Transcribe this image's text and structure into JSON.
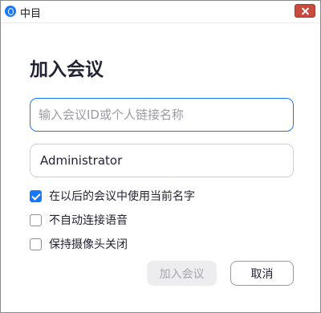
{
  "window": {
    "title": "中目"
  },
  "dialog": {
    "heading": "加入会议",
    "meeting_id_placeholder": "输入会议ID或个人链接名称",
    "meeting_id_value": "",
    "display_name_value": "Administrator",
    "options": [
      {
        "label": "在以后的会议中使用当前名字",
        "checked": true
      },
      {
        "label": "不自动连接语音",
        "checked": false
      },
      {
        "label": "保持摄像头关闭",
        "checked": false
      }
    ],
    "join_label": "加入会议",
    "cancel_label": "取消"
  },
  "colors": {
    "accent": "#1677ff",
    "close": "#c94b3f",
    "disabled_bg": "#ededf0",
    "text": "#232333"
  }
}
